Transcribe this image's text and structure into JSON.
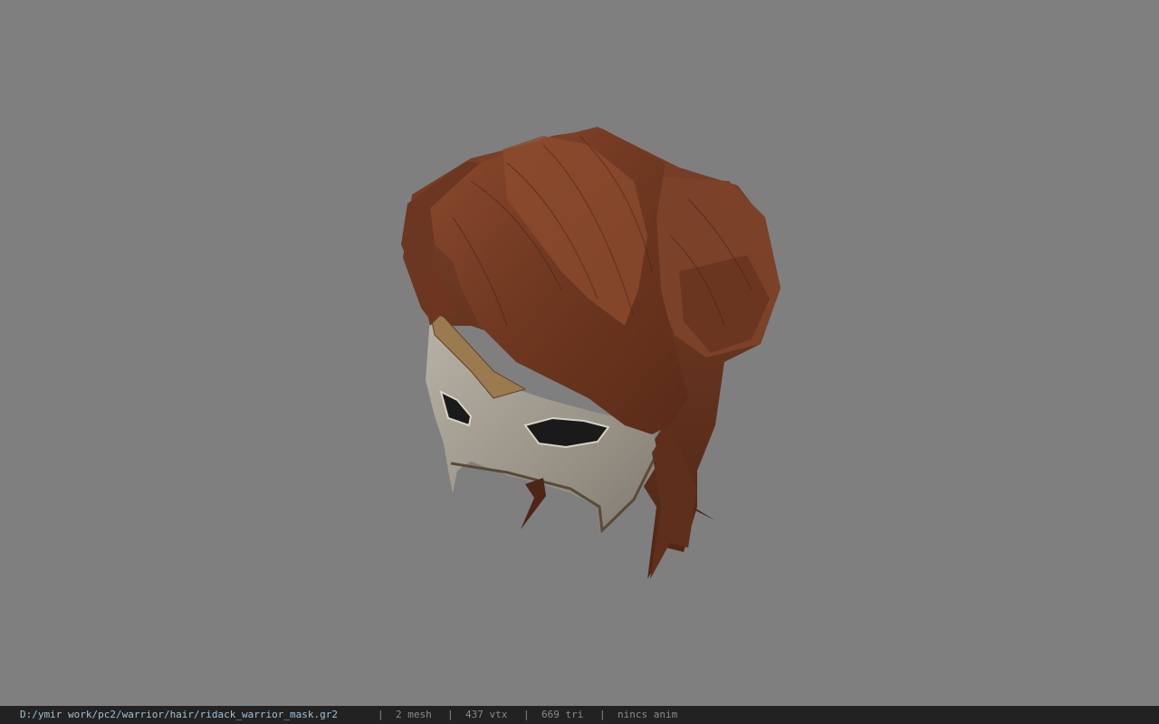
{
  "status_bar": {
    "file_path": "D:/ymir work/pc2/warrior/hair/ridack_warrior_mask.gr2",
    "separator": "|",
    "mesh_count": "2 mesh",
    "vertex_count": "437 vtx",
    "triangle_count": "669 tri",
    "animation": "nincs anim"
  },
  "colors": {
    "viewport_background": "#7f7f7f",
    "status_background": "#222222",
    "path_text": "#9fc0d6",
    "stat_text": "#8a8a8a",
    "hair": "#7a3f26",
    "mask": "#a49d90",
    "mask_trim": "#8a6a45"
  }
}
